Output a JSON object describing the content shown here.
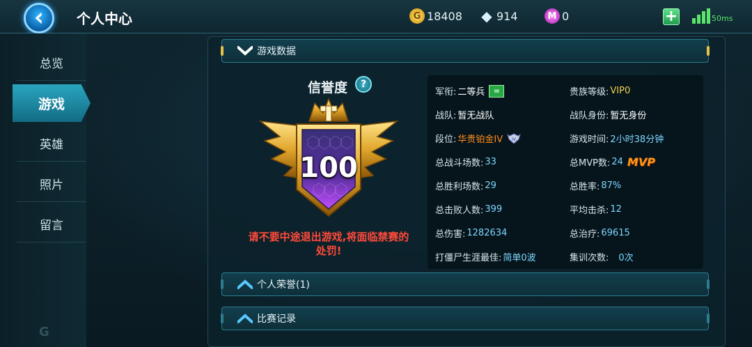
{
  "header": {
    "title": "个人中心",
    "currencies": [
      {
        "icon": "gold-coin-icon",
        "value": "18408"
      },
      {
        "icon": "diamond-icon",
        "value": "914"
      },
      {
        "icon": "purple-gem-icon",
        "value": "0"
      }
    ],
    "ping": "50ms"
  },
  "sidebar": {
    "items": [
      {
        "label": "总览",
        "active": false
      },
      {
        "label": "游戏",
        "active": true
      },
      {
        "label": "英雄",
        "active": false
      },
      {
        "label": "照片",
        "active": false
      },
      {
        "label": "留言",
        "active": false
      }
    ]
  },
  "sections": {
    "game_data": "游戏数据",
    "honors": "个人荣誉(1)",
    "match_records": "比赛记录"
  },
  "credit": {
    "title": "信誉度",
    "help": "?",
    "score": "100",
    "warning": "请不要中途退出游戏,将面临禁赛的处罚!"
  },
  "stats": {
    "rank_label": "军衔:",
    "rank_value": "二等兵",
    "rank_badge": "=",
    "vip_label": "贵族等级:",
    "vip_value": "VIP0",
    "team_label": "战队:",
    "team_value": "暂无战队",
    "team_role_label": "战队身份:",
    "team_role_value": "暂无身份",
    "tier_label": "段位:",
    "tier_value": "华贵铂金IV",
    "play_time_label": "游戏时间:",
    "play_time_value": "2小时38分钟",
    "battles_label": "总战斗场数:",
    "battles_value": "33",
    "mvp_label": "总MVP数:",
    "mvp_value": "24",
    "mvp_badge": "MVP",
    "wins_label": "总胜利场数:",
    "wins_value": "29",
    "winrate_label": "总胜率:",
    "winrate_value": "87%",
    "kills_label": "总击败人数:",
    "kills_value": "399",
    "avg_kills_label": "平均击杀:",
    "avg_kills_value": "12",
    "damage_label": "总伤害:",
    "damage_value": "1282634",
    "healing_label": "总治疗:",
    "healing_value": "69615",
    "zombie_label": "打僵尸生涯最佳:",
    "zombie_value": "简单0波",
    "training_label": "集训次数:",
    "training_value": "0次"
  },
  "colors": {
    "accent": "#2aa5bf",
    "warning": "#ff4a3a",
    "vip": "#f1d34a",
    "tier": "#ff8c1a",
    "value_blue": "#7fd7ff"
  }
}
